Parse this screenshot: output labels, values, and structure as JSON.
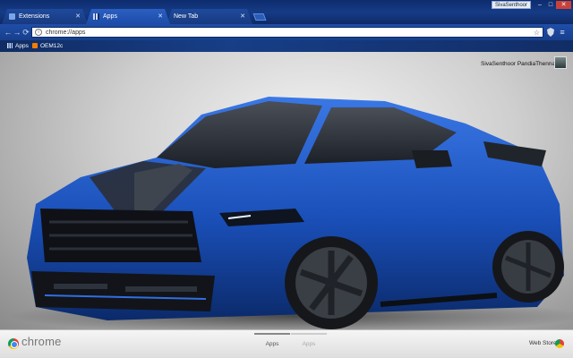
{
  "window": {
    "tabs": [
      {
        "label": "Extensions",
        "icon": "puzzle-icon"
      },
      {
        "label": "Apps",
        "icon": "apps-grid-icon"
      },
      {
        "label": "New Tab",
        "icon": ""
      }
    ],
    "profile_chip": "SivaSenthoor",
    "controls": {
      "minimize": "–",
      "maximize": "□",
      "close": "✕"
    }
  },
  "toolbar": {
    "back": "←",
    "forward": "→",
    "reload": "⟳",
    "url": "chrome://apps",
    "info": "i",
    "star": "☆",
    "menu": "≡"
  },
  "bookmarks": [
    {
      "label": "Apps",
      "icon": "apps-grid-icon"
    },
    {
      "label": "OEM12c",
      "icon": "blogger-icon"
    }
  ],
  "page": {
    "user_name": "SivaSenthoor PandiaThennavan"
  },
  "bottom_bar": {
    "brand": "chrome",
    "page_tabs": [
      "Apps",
      "Apps"
    ],
    "web_store": "Web Store"
  },
  "colors": {
    "frame": "#163b86",
    "car_body": "#1f5fd0",
    "stripe": "#2b2f36"
  }
}
